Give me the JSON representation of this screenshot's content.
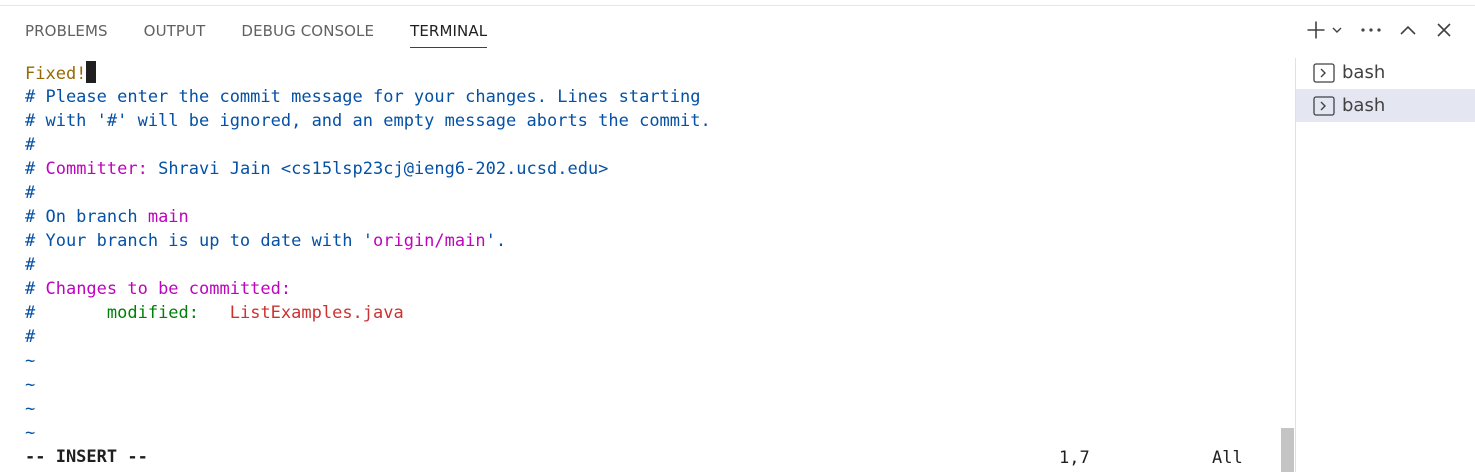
{
  "panel": {
    "tabs": [
      {
        "label": "PROBLEMS",
        "active": false
      },
      {
        "label": "OUTPUT",
        "active": false
      },
      {
        "label": "DEBUG CONSOLE",
        "active": false
      },
      {
        "label": "TERMINAL",
        "active": true
      }
    ],
    "actions": [
      "plus-icon",
      "chevron-down-icon",
      "ellipsis-icon",
      "chevron-up-icon",
      "close-icon"
    ]
  },
  "terminal": {
    "lines": [
      {
        "parts": [
          {
            "text": "Fixed!",
            "color": "brown"
          }
        ],
        "cursor": true
      },
      {
        "parts": [
          {
            "text": "# Please enter the commit message for your changes. Lines starting",
            "color": "blue"
          }
        ]
      },
      {
        "parts": [
          {
            "text": "# with '#' will be ignored, and an empty message aborts the commit.",
            "color": "blue"
          }
        ]
      },
      {
        "parts": [
          {
            "text": "#",
            "color": "blue"
          }
        ]
      },
      {
        "parts": [
          {
            "text": "# ",
            "color": "blue"
          },
          {
            "text": "Committer:",
            "color": "magenta"
          },
          {
            "text": " Shravi Jain <cs15lsp23cj@ieng6-202.ucsd.edu>",
            "color": "blue"
          }
        ]
      },
      {
        "parts": [
          {
            "text": "#",
            "color": "blue"
          }
        ]
      },
      {
        "parts": [
          {
            "text": "# On branch ",
            "color": "blue"
          },
          {
            "text": "main",
            "color": "magenta"
          }
        ]
      },
      {
        "parts": [
          {
            "text": "# Your branch is up to date with '",
            "color": "blue"
          },
          {
            "text": "origin/main",
            "color": "magenta"
          },
          {
            "text": "'.",
            "color": "blue"
          }
        ]
      },
      {
        "parts": [
          {
            "text": "#",
            "color": "blue"
          }
        ]
      },
      {
        "parts": [
          {
            "text": "# ",
            "color": "blue"
          },
          {
            "text": "Changes to be committed:",
            "color": "magenta"
          }
        ]
      },
      {
        "parts": [
          {
            "text": "#      ",
            "color": "blue"
          },
          {
            "text": " modified:",
            "color": "green"
          },
          {
            "text": "   ",
            "color": "blue"
          },
          {
            "text": "ListExamples.java",
            "color": "red"
          }
        ]
      },
      {
        "parts": [
          {
            "text": "#",
            "color": "blue"
          }
        ]
      },
      {
        "parts": [
          {
            "text": "~",
            "color": "blue"
          }
        ]
      },
      {
        "parts": [
          {
            "text": "~",
            "color": "blue"
          }
        ]
      },
      {
        "parts": [
          {
            "text": "~",
            "color": "blue"
          }
        ]
      },
      {
        "parts": [
          {
            "text": "~",
            "color": "blue"
          }
        ]
      },
      {
        "parts": [
          {
            "text": "-- INSERT --",
            "color": "black",
            "bold": true
          }
        ]
      }
    ],
    "status": {
      "position": "1,7",
      "scroll": "All"
    }
  },
  "terminals_list": [
    {
      "label": "bash",
      "icon": "terminal-icon",
      "selected": false
    },
    {
      "label": "bash",
      "icon": "terminal-icon",
      "selected": true
    }
  ],
  "colors": {
    "blue": "#0451a5",
    "magenta": "#bc05bc",
    "green": "#00800b",
    "red": "#cd3131",
    "brown": "#986801",
    "selected_bg": "#e4e6f1"
  }
}
